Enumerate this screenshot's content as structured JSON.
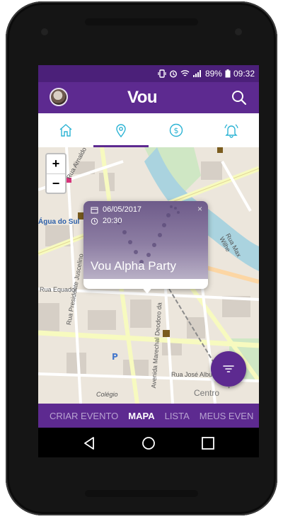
{
  "status": {
    "battery": "89%",
    "time": "09:32",
    "network": "4G"
  },
  "header": {
    "logo": "Vou",
    "avatar": "avatar",
    "search_icon": "search-icon"
  },
  "tabs": [
    {
      "icon": "home-icon",
      "selected": false
    },
    {
      "icon": "map-pin-icon",
      "selected": true
    },
    {
      "icon": "dollar-icon",
      "selected": false
    },
    {
      "icon": "bell-icon",
      "selected": false
    }
  ],
  "map": {
    "zoom_in": "+",
    "zoom_out": "−",
    "labels": {
      "rua_arnaldo_muller": "Rua Arnaldo Müller",
      "agua_do_sul": "Água do Sul",
      "rua_equador": "Rua Equador",
      "rua_presidente_juscelino": "Rua Presidente Juscelino",
      "avenida_marechal_deodoro": "Avenida Marechal Deodoro da",
      "rua_jose_albus": "Rua José Albus",
      "colegio": "Colégio",
      "centro": "Centro",
      "rua_max_wilhelm": "Rua Max Wilhe"
    }
  },
  "popup": {
    "date": "06/05/2017",
    "time": "20:30",
    "title": "Vou Alpha Party",
    "close": "×"
  },
  "bottom_tabs": [
    "CRIAR EVENTO",
    "MAPA",
    "LISTA",
    "MEUS EVEN"
  ],
  "bottom_tab_active": 1,
  "colors": {
    "primary": "#5d2a90",
    "status": "#4b2079",
    "accent": "#2bb3d4",
    "inactive_tab_text": "#b9a3d2"
  }
}
